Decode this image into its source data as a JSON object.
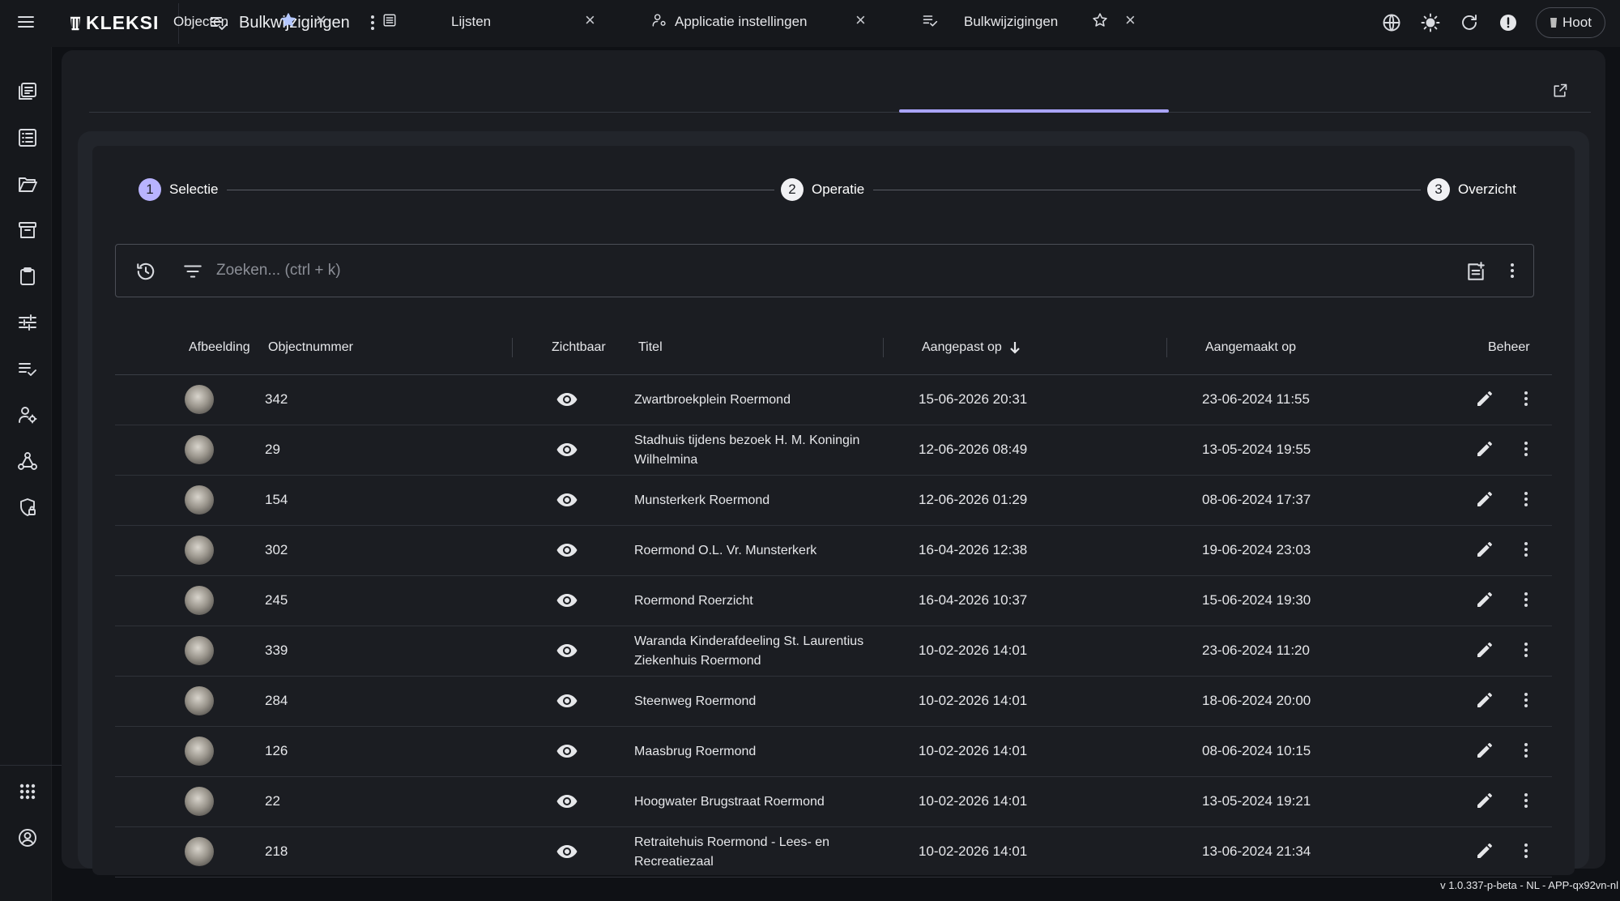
{
  "app": {
    "logo": "KLEKSI",
    "page_title": "Bulkwijzigingen",
    "user_label": "Hoot",
    "version": "v 1.0.337-p-beta - NL - APP-qx92vn-nl"
  },
  "tabs": [
    {
      "label": "Objecten",
      "starred": true
    },
    {
      "label": "Lijsten",
      "starred": false
    },
    {
      "label": "Applicatie instellingen",
      "starred": false
    },
    {
      "label": "Bulkwijzigingen",
      "starred": false,
      "active": true
    }
  ],
  "stepper": [
    {
      "num": "1",
      "label": "Selectie",
      "active": true
    },
    {
      "num": "2",
      "label": "Operatie",
      "active": false
    },
    {
      "num": "3",
      "label": "Overzicht",
      "active": false
    }
  ],
  "search": {
    "placeholder": "Zoeken... (ctrl + k)",
    "value": ""
  },
  "table": {
    "headers": {
      "image": "Afbeelding",
      "objectnumber": "Objectnummer",
      "visible": "Zichtbaar",
      "title": "Titel",
      "modified": "Aangepast op",
      "created": "Aangemaakt op",
      "manage": "Beheer"
    },
    "sort": {
      "column": "modified",
      "direction": "desc"
    },
    "rows": [
      {
        "num": "342",
        "title": "Zwartbroekplein Roermond",
        "modified": "15-06-2026 20:31",
        "created": "23-06-2024 11:55"
      },
      {
        "num": "29",
        "title": "Stadhuis tijdens bezoek H. M. Koningin Wilhelmina",
        "modified": "12-06-2026 08:49",
        "created": "13-05-2024 19:55"
      },
      {
        "num": "154",
        "title": "Munsterkerk Roermond",
        "modified": "12-06-2026 01:29",
        "created": "08-06-2024 17:37"
      },
      {
        "num": "302",
        "title": "Roermond O.L. Vr. Munsterkerk",
        "modified": "16-04-2026 12:38",
        "created": "19-06-2024 23:03"
      },
      {
        "num": "245",
        "title": "Roermond Roerzicht",
        "modified": "16-04-2026 10:37",
        "created": "15-06-2024 19:30"
      },
      {
        "num": "339",
        "title": "Waranda Kinderafdeeling St. Laurentius Ziekenhuis Roermond",
        "modified": "10-02-2026 14:01",
        "created": "23-06-2024 11:20"
      },
      {
        "num": "284",
        "title": "Steenweg Roermond",
        "modified": "10-02-2026 14:01",
        "created": "18-06-2024 20:00"
      },
      {
        "num": "126",
        "title": "Maasbrug Roermond",
        "modified": "10-02-2026 14:01",
        "created": "08-06-2024 10:15"
      },
      {
        "num": "22",
        "title": "Hoogwater Brugstraat Roermond",
        "modified": "10-02-2026 14:01",
        "created": "13-05-2024 19:21"
      },
      {
        "num": "218",
        "title": "Retraitehuis Roermond - Lees- en Recreatiezaal",
        "modified": "10-02-2026 14:01",
        "created": "13-06-2024 21:34"
      }
    ]
  },
  "colors": {
    "accent": "#a9a4ff",
    "background": "#0f1115",
    "surface": "#1b1d22",
    "text": "#e6e7ea"
  }
}
